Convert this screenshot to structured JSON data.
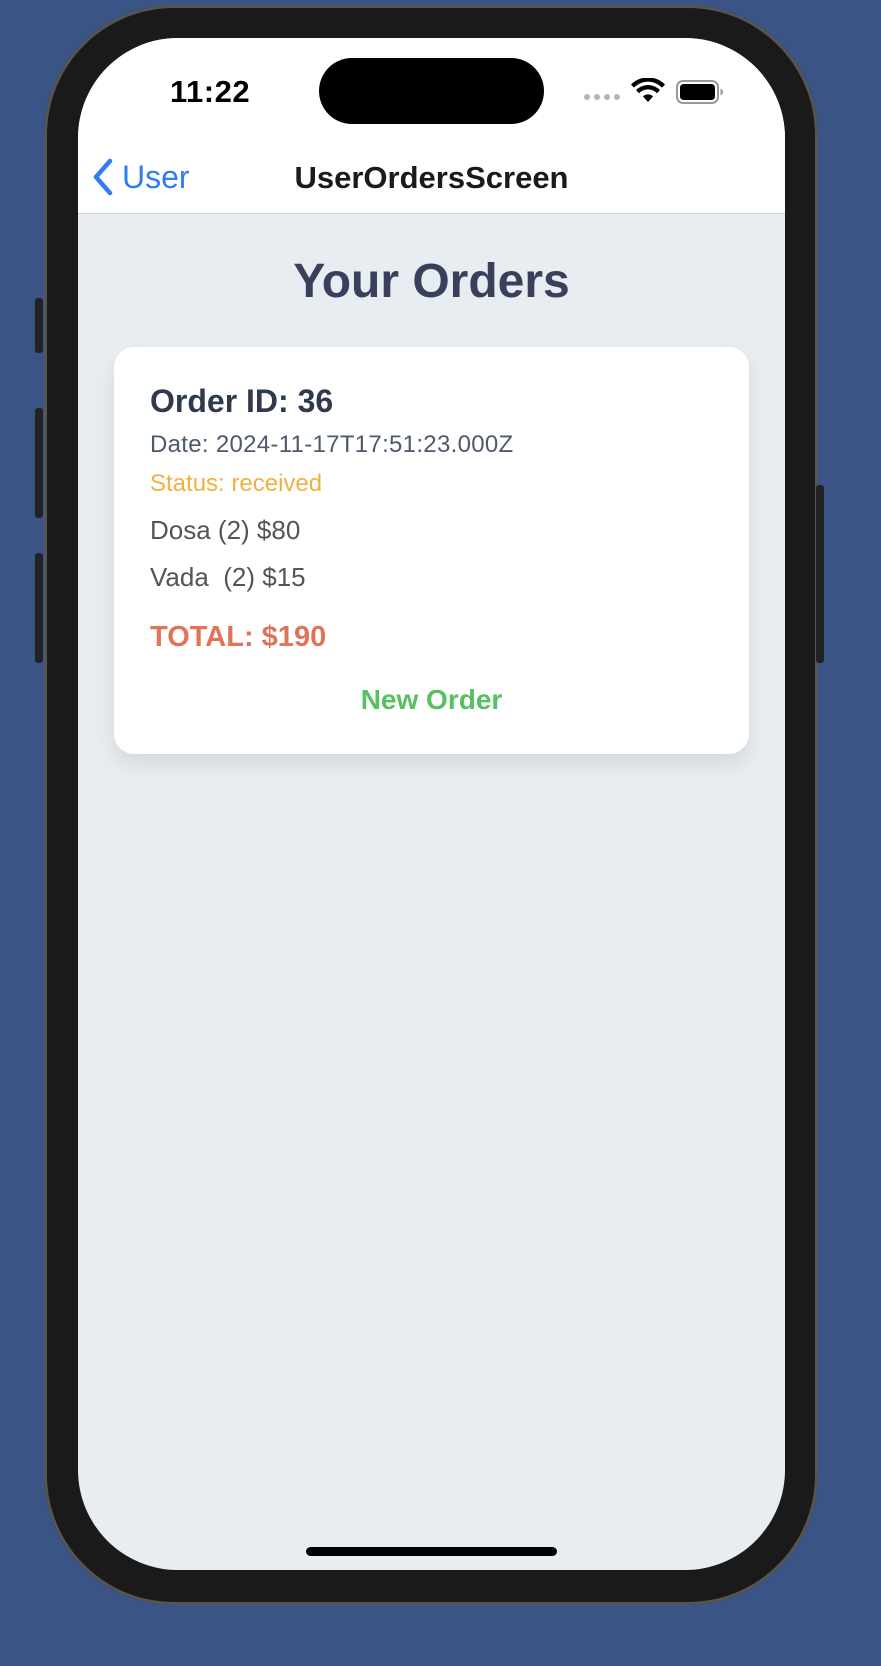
{
  "status_bar": {
    "time": "11:22"
  },
  "nav": {
    "back_label": "User",
    "title": "UserOrdersScreen"
  },
  "page": {
    "heading": "Your Orders"
  },
  "orders": [
    {
      "id_label": "Order ID: 36",
      "date_label": "Date: 2024-11-17T17:51:23.000Z",
      "status_label": "Status: received",
      "items": [
        "Dosa (2) $80",
        "Vada  (2) $15"
      ],
      "total_label": "TOTAL: $190",
      "action_label": "New Order"
    }
  ],
  "colors": {
    "background": "#3a5585",
    "screen_bg": "#e7edf0",
    "accent_link": "#2f7cf6",
    "status_color": "#f1b03f",
    "total_color": "#e07459",
    "action_color": "#55c160",
    "heading_color": "#3a3f5c"
  },
  "icons": {
    "back": "chevron-left-icon",
    "wifi": "wifi-icon",
    "battery": "battery-icon",
    "signal": "cellular-signal-icon"
  }
}
